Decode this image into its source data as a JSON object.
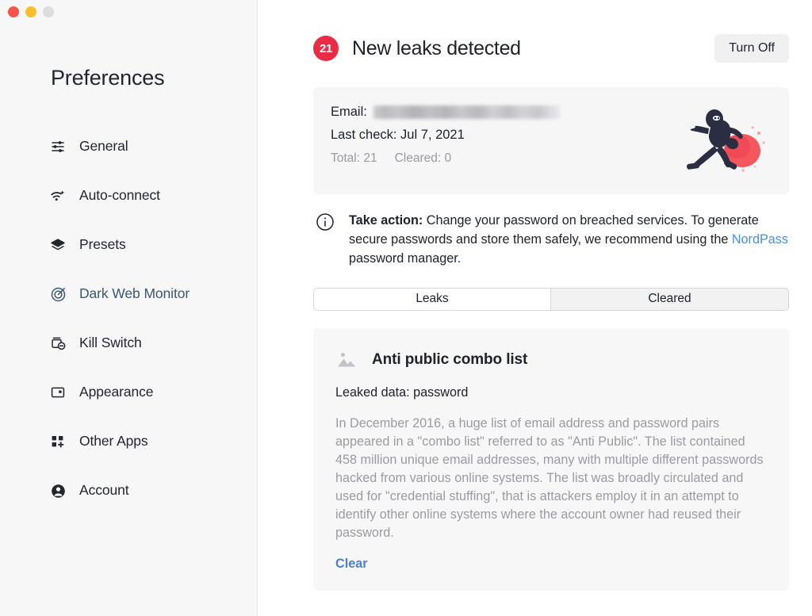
{
  "window": {
    "traffic_lights": {
      "close": "close-button",
      "minimize": "minimize-button",
      "zoom": "zoom-button"
    }
  },
  "sidebar": {
    "title": "Preferences",
    "items": [
      {
        "label": "General",
        "icon": "sliders-icon",
        "active": false
      },
      {
        "label": "Auto-connect",
        "icon": "wifi-sparkle-icon",
        "active": false
      },
      {
        "label": "Presets",
        "icon": "layers-icon",
        "active": false
      },
      {
        "label": "Dark Web Monitor",
        "icon": "target-icon",
        "active": true
      },
      {
        "label": "Kill Switch",
        "icon": "kill-switch-icon",
        "active": false
      },
      {
        "label": "Appearance",
        "icon": "window-panel-icon",
        "active": false
      },
      {
        "label": "Other Apps",
        "icon": "grid-plus-icon",
        "active": false
      },
      {
        "label": "Account",
        "icon": "person-circle-icon",
        "active": false
      }
    ]
  },
  "main": {
    "header": {
      "badge_count": "21",
      "title": "New leaks detected",
      "turn_off_label": "Turn Off"
    },
    "info_card": {
      "email_label": "Email:",
      "email_value": "",
      "last_check_label": "Last check:",
      "last_check_value": "Jul 7, 2021",
      "last_check_line": "Last check: Jul 7, 2021",
      "total_label": "Total: 21",
      "cleared_label": "Cleared: 0",
      "illustration": "running-thief-illustration"
    },
    "take_action": {
      "icon": "info-circle-icon",
      "bold_lead": "Take action:",
      "text_part1": " Change your password on breached services. To generate secure passwords and store them safely, we recommend using the ",
      "link_label": "NordPass",
      "text_part2": " password manager."
    },
    "tabs": [
      {
        "label": "Leaks",
        "active": true
      },
      {
        "label": "Cleared",
        "active": false
      }
    ],
    "leak_card": {
      "icon": "image-placeholder-icon",
      "title": "Anti public combo list",
      "leaked_data": "Leaked data: password",
      "description": "In December 2016, a huge list of email address and password pairs appeared in a \"combo list\" referred to as \"Anti Public\". The list contained 458 million unique email addresses, many with multiple different passwords hacked from various online systems. The list was broadly circulated and used for \"credential stuffing\", that is attackers employ it in an attempt to identify other online systems where the account owner had reused their password.",
      "clear_label": "Clear"
    }
  },
  "colors": {
    "accent_red": "#eb2a44",
    "link_blue": "#4a90d9",
    "clear_blue": "#4a7fd4",
    "active_nav": "#3a5876",
    "sidebar_bg": "#f7f7f8",
    "card_bg": "#f6f6f7",
    "muted_text": "#9a9aa0"
  }
}
